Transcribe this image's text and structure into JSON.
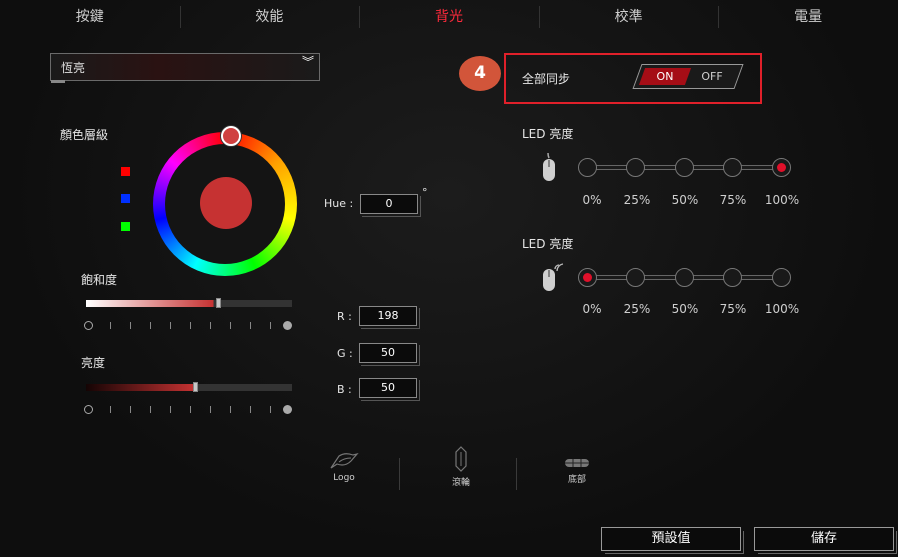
{
  "tabs": [
    "按鍵",
    "效能",
    "背光",
    "校準",
    "電量"
  ],
  "active_tab": "背光",
  "accent": "#ff2a3c",
  "effect": {
    "selected": "恆亮"
  },
  "color": {
    "title": "顏色層級",
    "current_hex": "#c63232",
    "hue_label": "Hue :",
    "hue": "0",
    "degree": "°",
    "r_label": "R :",
    "r": "198",
    "g_label": "G :",
    "g": "50",
    "b_label": "B :",
    "b": "50"
  },
  "saturation": {
    "label": "飽和度",
    "level": 0.64
  },
  "brightness": {
    "label": "亮度",
    "level": 0.53
  },
  "sync": {
    "badge": "4",
    "label": "全部同步",
    "on": "ON",
    "off": "OFF",
    "state": "ON"
  },
  "led_wired": {
    "title": "LED 亮度",
    "levels": [
      "0%",
      "25%",
      "50%",
      "75%",
      "100%"
    ],
    "selected": "100%"
  },
  "led_wireless": {
    "title": "LED 亮度",
    "levels": [
      "0%",
      "25%",
      "50%",
      "75%",
      "100%"
    ],
    "selected": "0%"
  },
  "zones": {
    "logo": "Logo",
    "wheel": "滾輪",
    "bottom": "底部"
  },
  "buttons": {
    "default": "預設值",
    "save": "儲存"
  }
}
